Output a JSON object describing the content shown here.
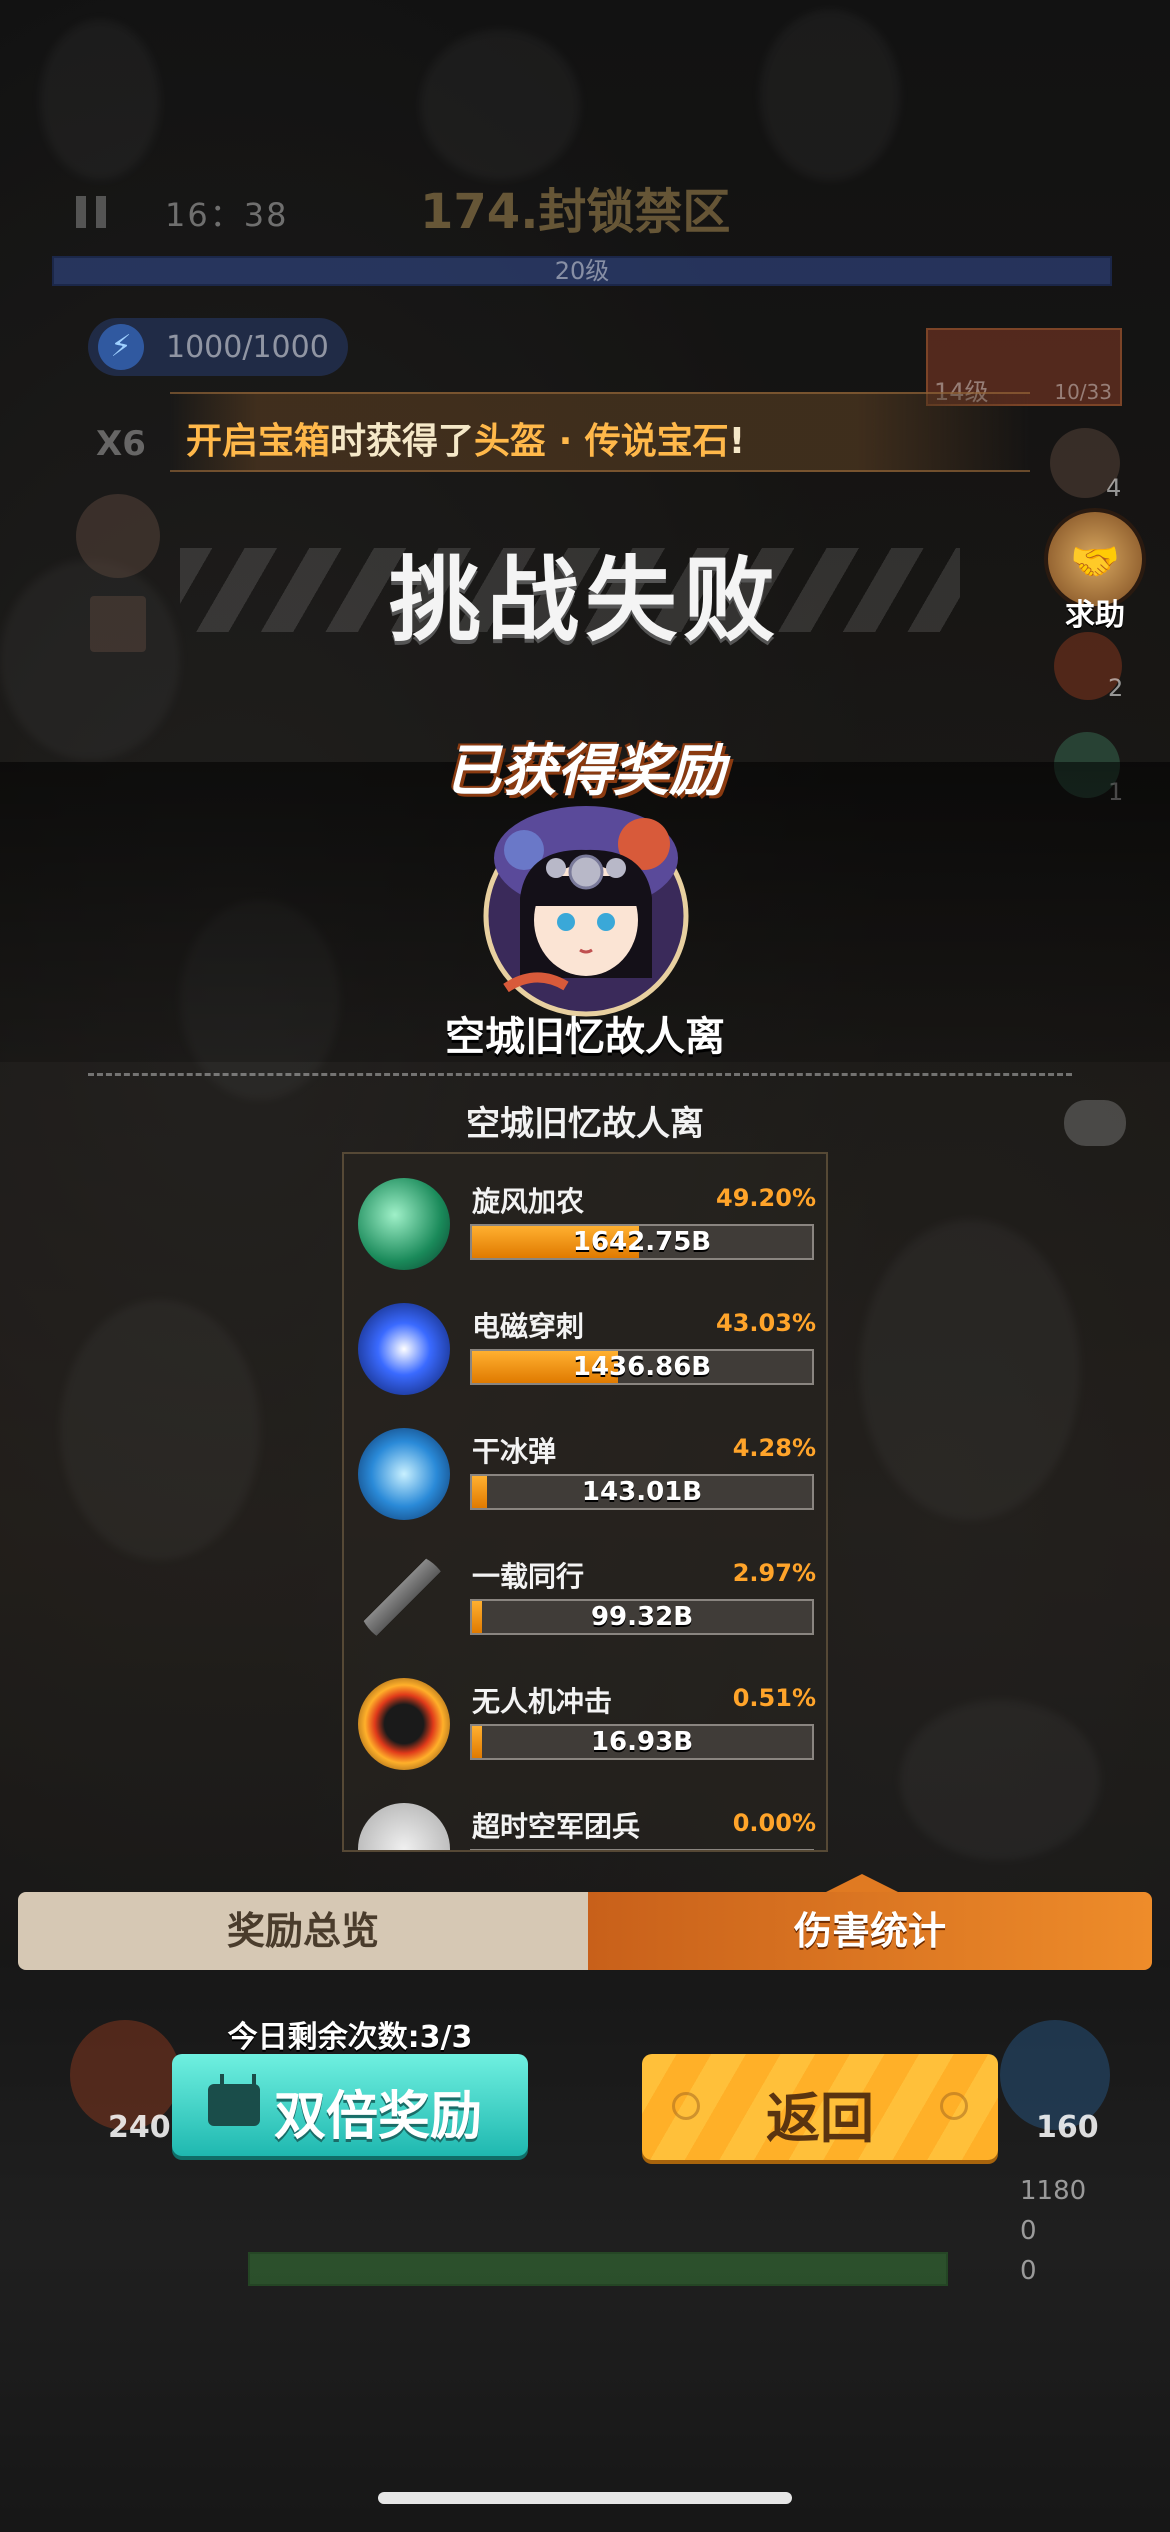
{
  "hud": {
    "timer": "16：38",
    "stage_title": "174.封锁禁区",
    "level_label": "20级",
    "energy": "1000/1000",
    "speed": "X6",
    "weapon_level": "14级",
    "weapon_count": "10/33"
  },
  "notice": {
    "prefix": "开启宝箱",
    "middle": "时获得了",
    "item": "头盔 · 传说宝石",
    "suffix": "!"
  },
  "result": {
    "title": "挑战失败"
  },
  "side": {
    "help_label": "求助",
    "counts": [
      "4",
      "2",
      "1"
    ]
  },
  "reward": {
    "title": "已获得奖励",
    "name": "空城旧忆故人离"
  },
  "stats": {
    "title": "空城旧忆故人离",
    "rows": [
      {
        "name": "旋风加农",
        "percent": "49.20%",
        "value": "1642.75B",
        "fraction": 0.492,
        "icon": "tornado-icon"
      },
      {
        "name": "电磁穿刺",
        "percent": "43.03%",
        "value": "1436.86B",
        "fraction": 0.4303,
        "icon": "lightning-icon"
      },
      {
        "name": "干冰弹",
        "percent": "4.28%",
        "value": "143.01B",
        "fraction": 0.0428,
        "icon": "ice-bullet-icon"
      },
      {
        "name": "一载同行",
        "percent": "2.97%",
        "value": "99.32B",
        "fraction": 0.0297,
        "icon": "rifle-icon"
      },
      {
        "name": "无人机冲击",
        "percent": "0.51%",
        "value": "16.93B",
        "fraction": 0.0051,
        "icon": "drone-icon"
      },
      {
        "name": "超时空军团兵",
        "percent": "0.00%",
        "value": "",
        "fraction": 0,
        "icon": "soldier-icon"
      }
    ]
  },
  "tabs": {
    "left": "奖励总览",
    "right": "伤害统计"
  },
  "actions": {
    "remaining": "今日剩余次数:3/3",
    "double_label": "双倍奖励",
    "return_label": "返回"
  },
  "bottom": {
    "left_skill_count": "240",
    "right_skill_count": "160",
    "right_stats": [
      "1180",
      "0",
      "0"
    ]
  },
  "colors": {
    "accent_orange": "#ffa42a",
    "teal": "#1fb8b0",
    "tab_active": "#ee8c2a"
  }
}
